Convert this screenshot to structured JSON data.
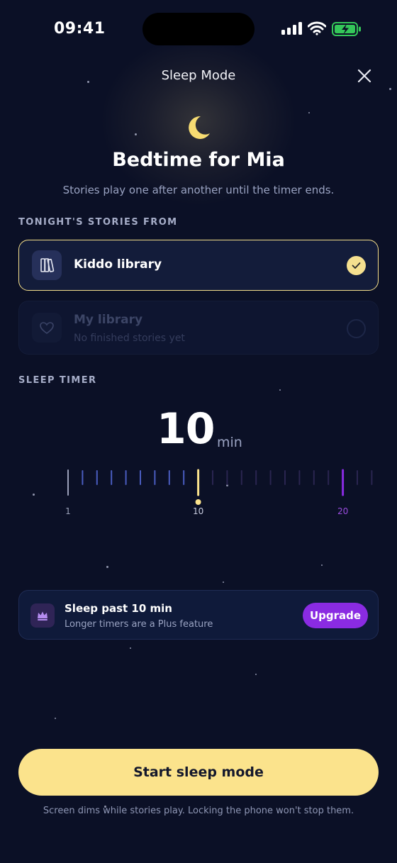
{
  "status_bar": {
    "time": "09:41",
    "icons": [
      "cellular-signal-icon",
      "wifi-icon",
      "battery-charging-icon"
    ],
    "battery_color": "#34c759"
  },
  "header": {
    "title": "Sleep Mode",
    "close_icon": "close-icon"
  },
  "hero": {
    "icon": "moon-icon",
    "title": "Bedtime for Mia",
    "subtitle": "Stories play one after another until the timer ends."
  },
  "stories_section": {
    "label": "TONIGHT'S STORIES FROM",
    "options": [
      {
        "label": "Kiddo library",
        "sublabel": "",
        "icon": "books-icon",
        "selected": true,
        "enabled": true
      },
      {
        "label": "My library",
        "sublabel": "No finished stories yet",
        "icon": "heart-icon",
        "selected": false,
        "enabled": false
      }
    ]
  },
  "timer_section": {
    "label": "SLEEP TIMER",
    "value": "10",
    "unit": "min",
    "min": 1,
    "max_free": 10,
    "plus_mark": 20,
    "selected": 10,
    "tick_labels": [
      "1",
      "10",
      "20"
    ]
  },
  "upgrade": {
    "icon": "crown-icon",
    "title": "Sleep past 10 min",
    "subtitle": "Longer timers are a Plus feature",
    "button_label": "Upgrade"
  },
  "cta": {
    "label": "Start sleep mode",
    "footnote": "Screen dims while stories play. Locking the phone won't stop them."
  },
  "colors": {
    "background": "#0b1026",
    "accent_yellow": "#fbe38c",
    "accent_purple": "#8a2be2",
    "tick_blue": "#4a5dc0",
    "tick_locked": "#2a2550"
  }
}
